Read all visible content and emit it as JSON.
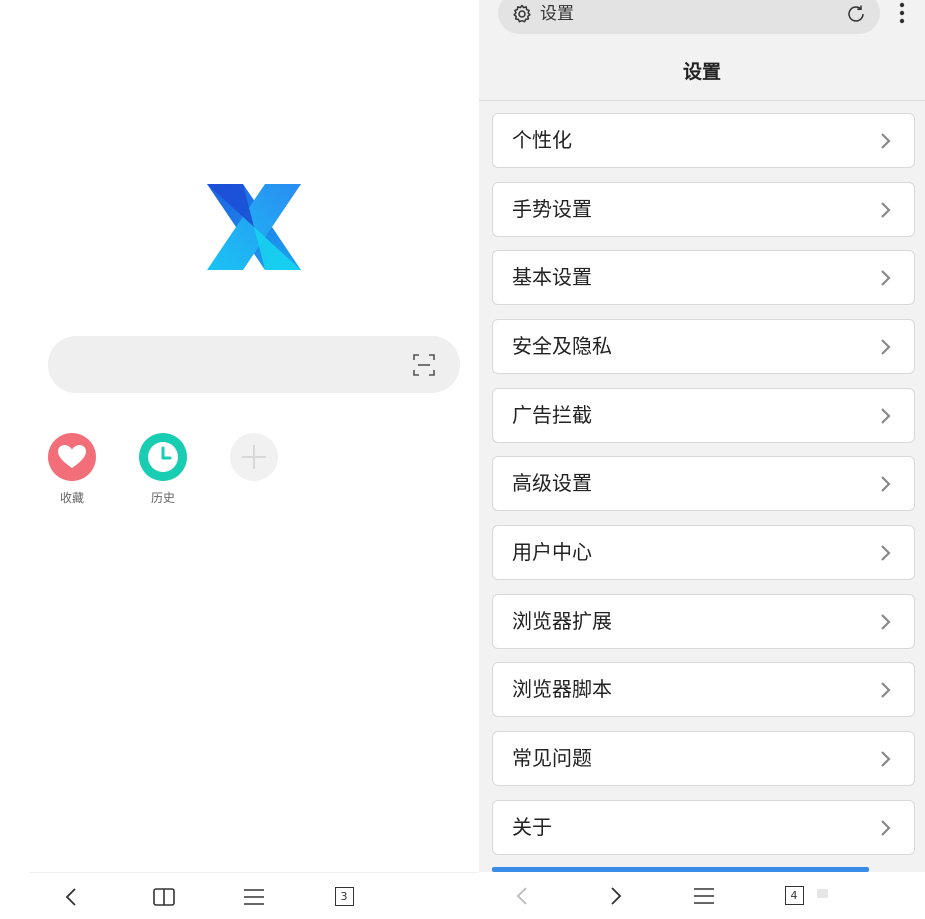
{
  "left_pane": {
    "shortcuts": [
      {
        "label": "收藏",
        "icon": "heart-icon",
        "color": "#f26f79"
      },
      {
        "label": "历史",
        "icon": "clock-icon",
        "color": "#19cdb3"
      },
      {
        "label": "",
        "icon": "plus-icon",
        "color": "#f1f1f1"
      }
    ],
    "tab_count": "3"
  },
  "right_pane": {
    "url_bar": {
      "text": "设置"
    },
    "page_title": "设置",
    "settings_items": [
      "个性化",
      "手势设置",
      "基本设置",
      "安全及隐私",
      "广告拦截",
      "高级设置",
      "用户中心",
      "浏览器扩展",
      "浏览器脚本",
      "常见问题",
      "关于"
    ],
    "tab_count": "4"
  },
  "colors": {
    "logo_blue": "#1e6fe6",
    "logo_cyan": "#18d6f2",
    "accent_strip": "#3a8de6"
  }
}
